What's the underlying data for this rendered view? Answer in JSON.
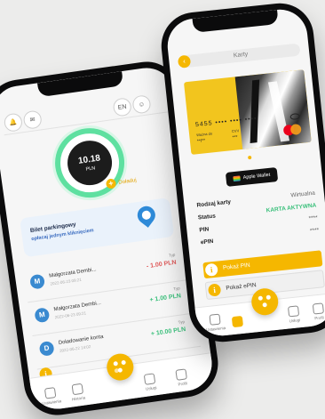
{
  "colors": {
    "accent": "#f5b700",
    "positive": "#3cc07c",
    "negative": "#e05a5a",
    "ring": "#5ee0a0"
  },
  "left_phone": {
    "header": {
      "bell_badge": "10",
      "cart_label": "EN"
    },
    "balance": {
      "amount": "10.18",
      "currency": "PLN"
    },
    "topup_label": "Doładuj",
    "banner": {
      "title": "Bilet parkingowy",
      "subtitle": "opłacaj jednym kliknięciem"
    },
    "transactions": [
      {
        "avatar": "M",
        "name": "Małgorzata Dembi...",
        "date": "2022-06-23 09:21",
        "type": "Typ",
        "amount": "- 1.00 PLN",
        "sign": "neg"
      },
      {
        "avatar": "M",
        "name": "Małgorzata Dembi...",
        "date": "2022-06-23 09:21",
        "type": "Typ",
        "amount": "+ 1.00 PLN",
        "sign": "pos"
      },
      {
        "avatar": "D",
        "name": "Doładowanie konta",
        "date": "2022-06-22 14:02",
        "type": "Typ",
        "amount": "+ 10.00 PLN",
        "sign": "pos"
      }
    ],
    "nav": [
      "Ustawienia",
      "Historia",
      "",
      "Usługi",
      "Profil"
    ]
  },
  "right_phone": {
    "title": "Karty",
    "card": {
      "number": "5455 •••• •••• ••••",
      "expiry_label": "Ważna do",
      "expiry": "**/**",
      "cvv_label": "CVV",
      "cvv": "***"
    },
    "wallet_label": "Apple Wallet",
    "details": [
      {
        "key": "Rodzaj karty",
        "value": "Wirtualna",
        "style": ""
      },
      {
        "key": "Status",
        "value": "KARTA AKTYWNA",
        "style": "active"
      },
      {
        "key": "PIN",
        "value": "****",
        "style": ""
      },
      {
        "key": "ePIN",
        "value": "****",
        "style": ""
      }
    ],
    "show_pin_label": "Pokaż PIN",
    "show_epin_label": "Pokaż ePIN",
    "nav": [
      "Ustawienia",
      "",
      "",
      "Usługi",
      "Profil"
    ]
  }
}
